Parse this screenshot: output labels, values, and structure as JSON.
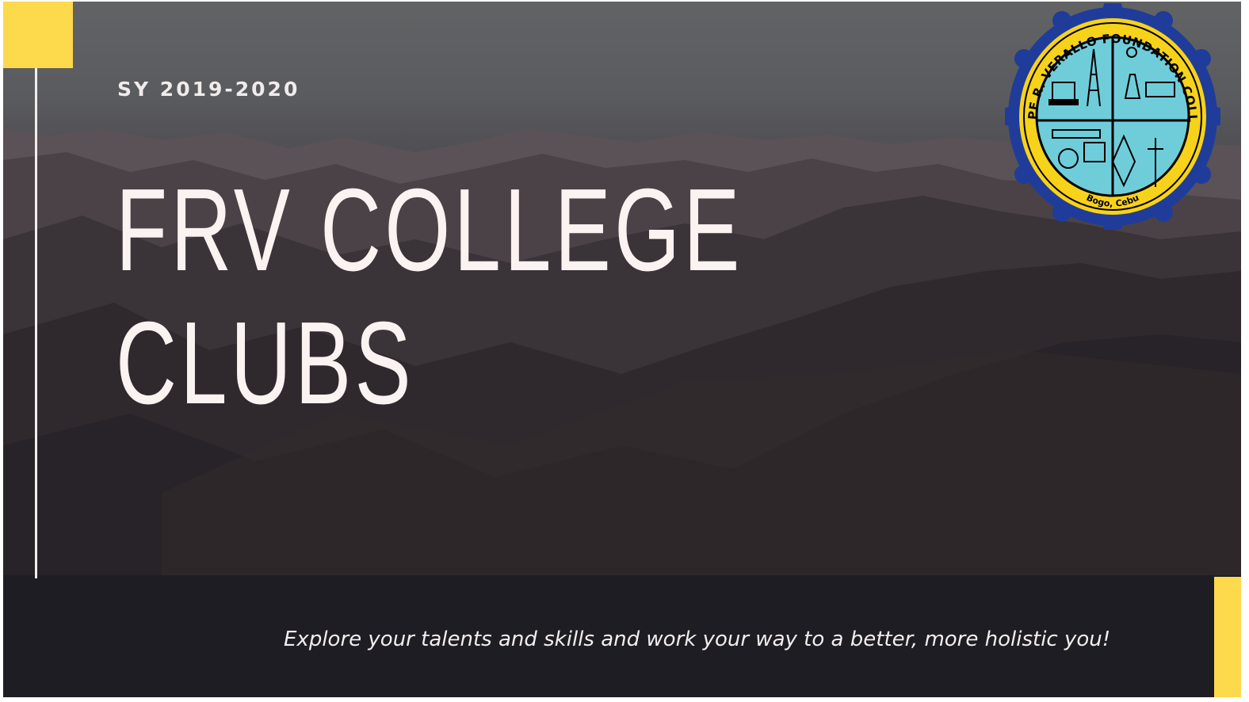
{
  "slide": {
    "school_year": "SY 2019-2020",
    "title_line1": "FRV COLLEGE",
    "title_line2": "CLUBS",
    "tagline": "Explore your talents and skills and work your way to a better, more holistic you!"
  },
  "logo": {
    "name": "FELIPE R. VERALLO FOUNDATION COLLEGE",
    "location": "Bogo, Cebu",
    "icon": "college-seal-icon"
  },
  "colors": {
    "accent": "#fdd94c",
    "text": "#fbf2f2",
    "seal_blue": "#1f3c9a",
    "seal_yellow": "#f7d21a",
    "seal_light_blue": "#6fcdda"
  }
}
